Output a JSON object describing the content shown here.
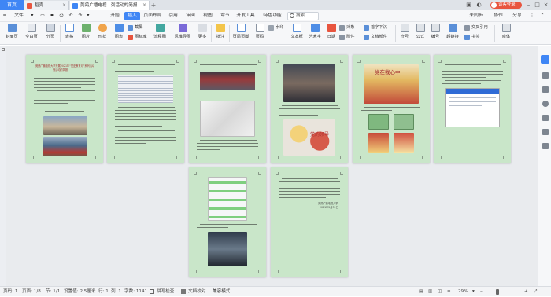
{
  "tabs": {
    "home": "首页",
    "items": [
      {
        "label": "稻壳",
        "color": "#e8553f"
      },
      {
        "label": "莞鸽广播电视...列活动的简报",
        "color": "#3f86f5"
      }
    ],
    "login": "访客登录"
  },
  "menu": {
    "file": "文件",
    "items": [
      "开始",
      "插入",
      "页面布局",
      "引用",
      "审阅",
      "视图",
      "章节",
      "开发工具",
      "特色功能"
    ],
    "active": "插入",
    "search": "搜索",
    "right": [
      "未同步",
      "协作",
      "分享"
    ]
  },
  "ribbon": {
    "big": [
      "封面页",
      "空白页",
      "分页",
      "表格",
      "图片",
      "形状",
      "图表",
      "流程图",
      "思维导图",
      "更多",
      "批注",
      "页眉页脚",
      "页码",
      "文本框",
      "艺术字",
      "日期",
      "符号",
      "公式",
      "编号",
      "超链接",
      "书签",
      "窗体"
    ],
    "small": {
      "shot": "截屏",
      "icon": "图标库",
      "func": "功能图",
      "watermark": "水印",
      "object": "对象",
      "attach": "附件",
      "first_drop": "首字下沉",
      "doc_parts": "文档部件",
      "crossref": "交叉引用"
    }
  },
  "pages": {
    "p1_title": "莞鸽广播电视大学开展2021年“党史教育月”系列活动的简报",
    "p1_sub": "列活动的简报",
    "p4_banner": "党在我心中",
    "p3_banner": "党的领导",
    "p8_sign1": "莞鸽广播电视大学",
    "p8_sign2": "2021年5月31日"
  },
  "status": {
    "page": "页码: 1",
    "pages": "页面: 1/8",
    "section": "节: 1/1",
    "setting": "设置值: 2.5厘米",
    "row": "行: 1",
    "col": "列: 1",
    "words": "字数: 1141",
    "spell": "拼写检查",
    "proof": "文档校对",
    "compat": "兼容模式",
    "zoom": "29%"
  },
  "colors": {
    "accent": "#3f86f5",
    "page": "#c9e6c9",
    "brand_red": "#e8553f"
  }
}
